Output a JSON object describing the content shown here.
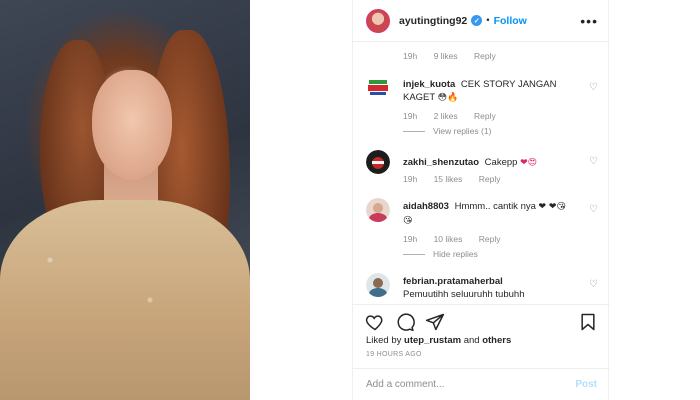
{
  "post": {
    "username": "ayutingting92",
    "follow_label": "Follow",
    "separator": "•",
    "more_label": "•••",
    "verified_mark": "✓"
  },
  "top_meta": {
    "time": "19h",
    "likes": "9 likes",
    "reply": "Reply"
  },
  "comments": [
    {
      "username": "injek_kuota",
      "text": "CEK STORY JANGAN KAGET",
      "emoji": "😳🔥",
      "time": "19h",
      "likes": "2 likes",
      "reply": "Reply",
      "replies_toggle": "View replies (1)",
      "avatar_icon": "injek-kuota-logo"
    },
    {
      "username": "zakhi_shenzutao",
      "text": "Cakepp",
      "emoji": "❤😍",
      "time": "19h",
      "likes": "15 likes",
      "reply": "Reply"
    },
    {
      "username": "aidah8803",
      "text": "Hmmm.. cantik nya",
      "emoji": "❤ ❤😘😘",
      "time": "19h",
      "likes": "10 likes",
      "reply": "Reply",
      "replies_toggle": "Hide replies"
    },
    {
      "username": "febrian.pratamaherbal",
      "text": "Pemuutihh seluuruhh tubuhh"
    }
  ],
  "liked_by": {
    "prefix": "Liked by",
    "user": "utep_rustam",
    "middle": "and",
    "others": "others"
  },
  "time_ago": "19 HOURS AGO",
  "add_comment": {
    "placeholder": "Add a comment...",
    "post_label": "Post"
  },
  "colors": {
    "link_blue": "#0095f6",
    "verified_blue": "#3897f0",
    "muted": "#8e8e8e",
    "post_disabled": "#b2dffc"
  }
}
